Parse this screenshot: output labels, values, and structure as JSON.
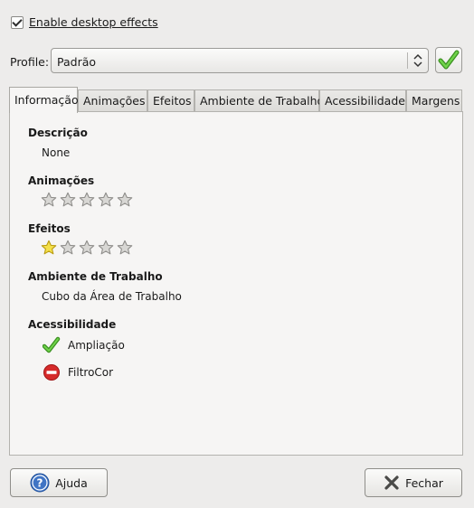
{
  "enable_effects": {
    "label": "Enable desktop effects",
    "checked": true
  },
  "profile": {
    "label": "Profile:",
    "value": "Padrão"
  },
  "tabs": [
    {
      "label": "Informação",
      "active": true
    },
    {
      "label": "Animações"
    },
    {
      "label": "Efeitos"
    },
    {
      "label": "Ambiente de Trabalho"
    },
    {
      "label": "Acessibilidade"
    },
    {
      "label": "Margens"
    }
  ],
  "info": {
    "descricao": {
      "title": "Descrição",
      "value": "None"
    },
    "animacoes": {
      "title": "Animações",
      "rating": 0,
      "max": 5
    },
    "efeitos": {
      "title": "Efeitos",
      "rating": 1,
      "max": 5
    },
    "ambiente": {
      "title": "Ambiente de Trabalho",
      "value": "Cubo da Área de Trabalho"
    },
    "acessibilidade": {
      "title": "Acessibilidade",
      "items": [
        {
          "label": "Ampliação",
          "status": "enabled",
          "icon": "check-icon"
        },
        {
          "label": "FiltroCor",
          "status": "disabled",
          "icon": "no-entry-icon"
        }
      ]
    }
  },
  "buttons": {
    "help": {
      "label": "Ajuda",
      "icon": "help-icon"
    },
    "close": {
      "label": "Fechar",
      "icon": "close-icon"
    }
  },
  "colors": {
    "star_filled": "#f4e04a",
    "check_green": "#47b52e",
    "stop_red": "#d62a2a"
  }
}
